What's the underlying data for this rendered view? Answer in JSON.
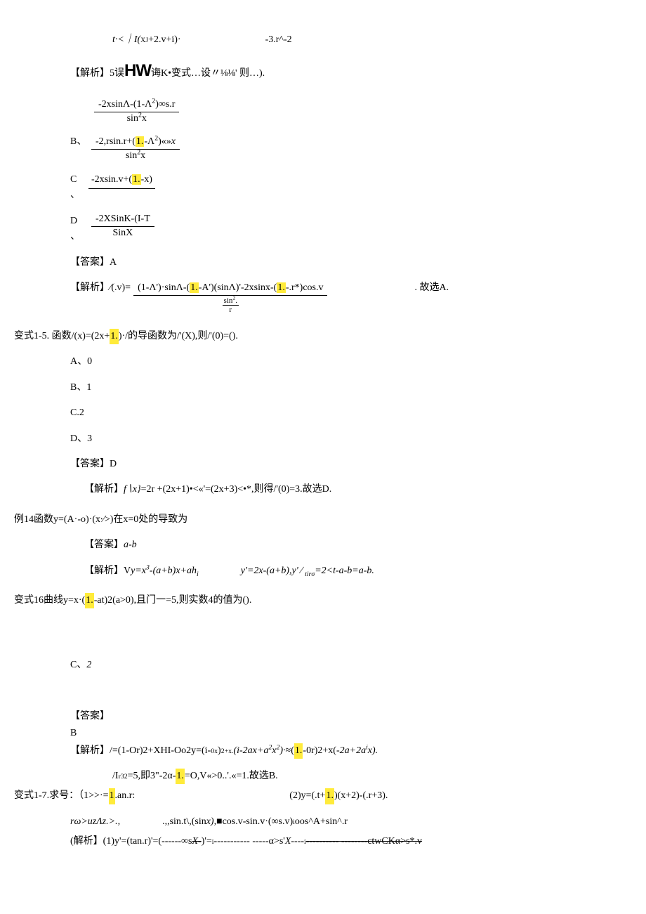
{
  "line1": {
    "a": "t·<｜I(",
    "sup": "XJ",
    "b": "+2.v+i)·",
    "c": "-3.r^-2"
  },
  "line2": {
    "a": "【解析】5误",
    "hw": "HW",
    "b": "诲K•变式…设〃⅛⅛' 则…)."
  },
  "fracA": {
    "num_a": "-2xsinΛ-(1-Λ",
    "num_sup": "2",
    "num_b": ")∞s.r",
    "den": "sin",
    "den_sup": "2",
    "den_b": "x"
  },
  "optB": {
    "label": "B、",
    "num_a": "-2,rsin.r+(",
    "hl": "1.",
    "num_b": "-Λ",
    "num_sup": "2",
    "num_c": ")«»",
    "num_i": "x",
    "den": "sin",
    "den_sup": "2",
    "den_b": "x"
  },
  "optC": {
    "label_a": "C",
    "label_b": "、",
    "num_a": "-2xsin.v+(",
    "hl": "1.",
    "num_b": "-x)"
  },
  "optD": {
    "label_a": "D",
    "label_b": "、",
    "num": "-2XSinK-(I-T",
    "den": "SinX"
  },
  "ansA": "【答案】A",
  "expA": {
    "a": "【解析】∕(.v)=",
    "num_a": "(1-Λ')·sinΛ-(",
    "hl1": "1.",
    "num_b": "-A')(sinΛ)'-2xsinx-(",
    "hl2": "1.",
    "num_c": "-.r*)cos.v",
    "den_a": "sin",
    "den_sup": "2",
    "den_b": ".",
    "den_c": "r",
    "tail": ". 故选A."
  },
  "q15": {
    "a": "变式1-5. 函数/(x)=(2x+",
    "hl": "1.",
    "b": ")·/的导函数为/'(X),则/'(0)=()."
  },
  "q15a": "A、0",
  "q15b": "B、1",
  "q15c": "C.2",
  "q15d": "D、3",
  "ans15": "【答案】D",
  "exp15": {
    "a": "【解析】",
    "i": "f∖x}",
    "b": "=2r +(2x+1)•<«'=(2x+3)<•*,则得/'(0)=3.故选D."
  },
  "q14": "例14函数y=(A·-o)·(x∙∕>)在x=0处的导致为",
  "ans14": {
    "a": "【答案】",
    "i": "a-b"
  },
  "exp14": {
    "a": "【解析】V",
    "i1": "y=x",
    "sup1": "3",
    "i2": "-(a+b)x+ah",
    "sub1": "i",
    "b": "y'=2x-(a+b),y' ∕ ",
    "sub2": "tirσ",
    "c": "=2<t-a-b=a-b."
  },
  "q16": {
    "a": "变式16曲线y=x·(",
    "hl": "1.",
    "b": "-at)2(a>0),且门一=5,则实数4的值为()."
  },
  "q16c": {
    "a": "C、",
    "i": "2"
  },
  "ans16a": "【答案】",
  "ans16b": "B",
  "exp16a": {
    "a": "【解析】/=(1-Or)2+XHI-Oo2y=(i-",
    "sub": "0x",
    "b": ")",
    "sup": "2",
    "sub2": "+x.",
    "i": "(i-2ax+a",
    "sup2": "2",
    "i2": "x",
    "sup3": "2",
    "i3": ")·",
    "c": "≈(",
    "hl": "1.",
    "d": "-0r)2+x(",
    "i4": "-2a+2a",
    "sup4": "i",
    "i5": "x)."
  },
  "exp16b": {
    "a": "/I",
    "sub": "r32",
    "b": "=5,即3\"-2α-",
    "hl": "1.",
    "c": "=O,V«>0..'.«=1.故选B."
  },
  "q17": {
    "a": "变式1-7.求号：（1>>·=",
    "hl": "1",
    "b": ".an.r:",
    "c": "(2)y=(.t+",
    "hl2": "1.",
    "d": ")(x+2)-(.r+3)."
  },
  "line_r": {
    "i": "rω>uzΛz.>.,",
    "b": ".,,sin.t\\,(sin",
    "i2": "x),",
    "c": "■cos.v-sin.v·(∞s.v)",
    "sup": "i",
    "d": "oos^A+sin^.r"
  },
  "line_last": {
    "a": "(解析】(1)y'=(tan.r)'=(------∞s",
    "i": "X-",
    "b": ")'=",
    "sup": "i",
    "c": "----------- -----α>s'",
    "i2": "X",
    "d": "  ----",
    "sup2": "i",
    "e": "---------- --------ctwCKα>s*.v"
  }
}
